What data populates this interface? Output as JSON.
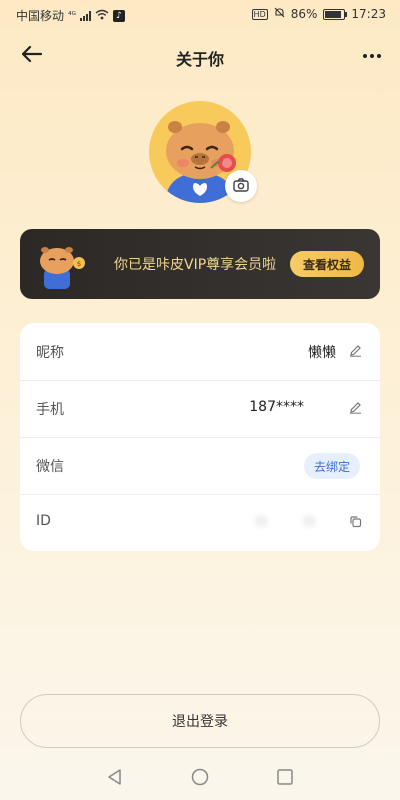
{
  "status_bar": {
    "carrier": "中国移动",
    "network": "⁴ᴳ",
    "battery": "86%",
    "battery_level": 0.86,
    "time": "17:23"
  },
  "header": {
    "title": "关于你"
  },
  "vip": {
    "text": "你已是咔皮VIP尊享会员啦",
    "button": "查看权益"
  },
  "profile": {
    "rows": [
      {
        "label": "昵称",
        "value": "懒懒"
      },
      {
        "label": "手机",
        "value": "187****"
      },
      {
        "label": "微信",
        "action": "去绑定"
      },
      {
        "label": "ID"
      }
    ]
  },
  "logout_label": "退出登录",
  "colors": {
    "background_top": "#fde9c4",
    "vip_banner": "#2b2826",
    "vip_text": "#f3d58f",
    "vip_button": "#f6cc66",
    "bind_button_bg": "#e7eefc",
    "bind_button_text": "#3b6fd6",
    "avatar_bg": "#f8c95b"
  },
  "icons": [
    "back-arrow-icon",
    "more-dots-icon",
    "camera-icon",
    "edit-pencil-icon",
    "copy-icon",
    "nav-back-icon",
    "nav-home-icon",
    "nav-recents-icon"
  ]
}
